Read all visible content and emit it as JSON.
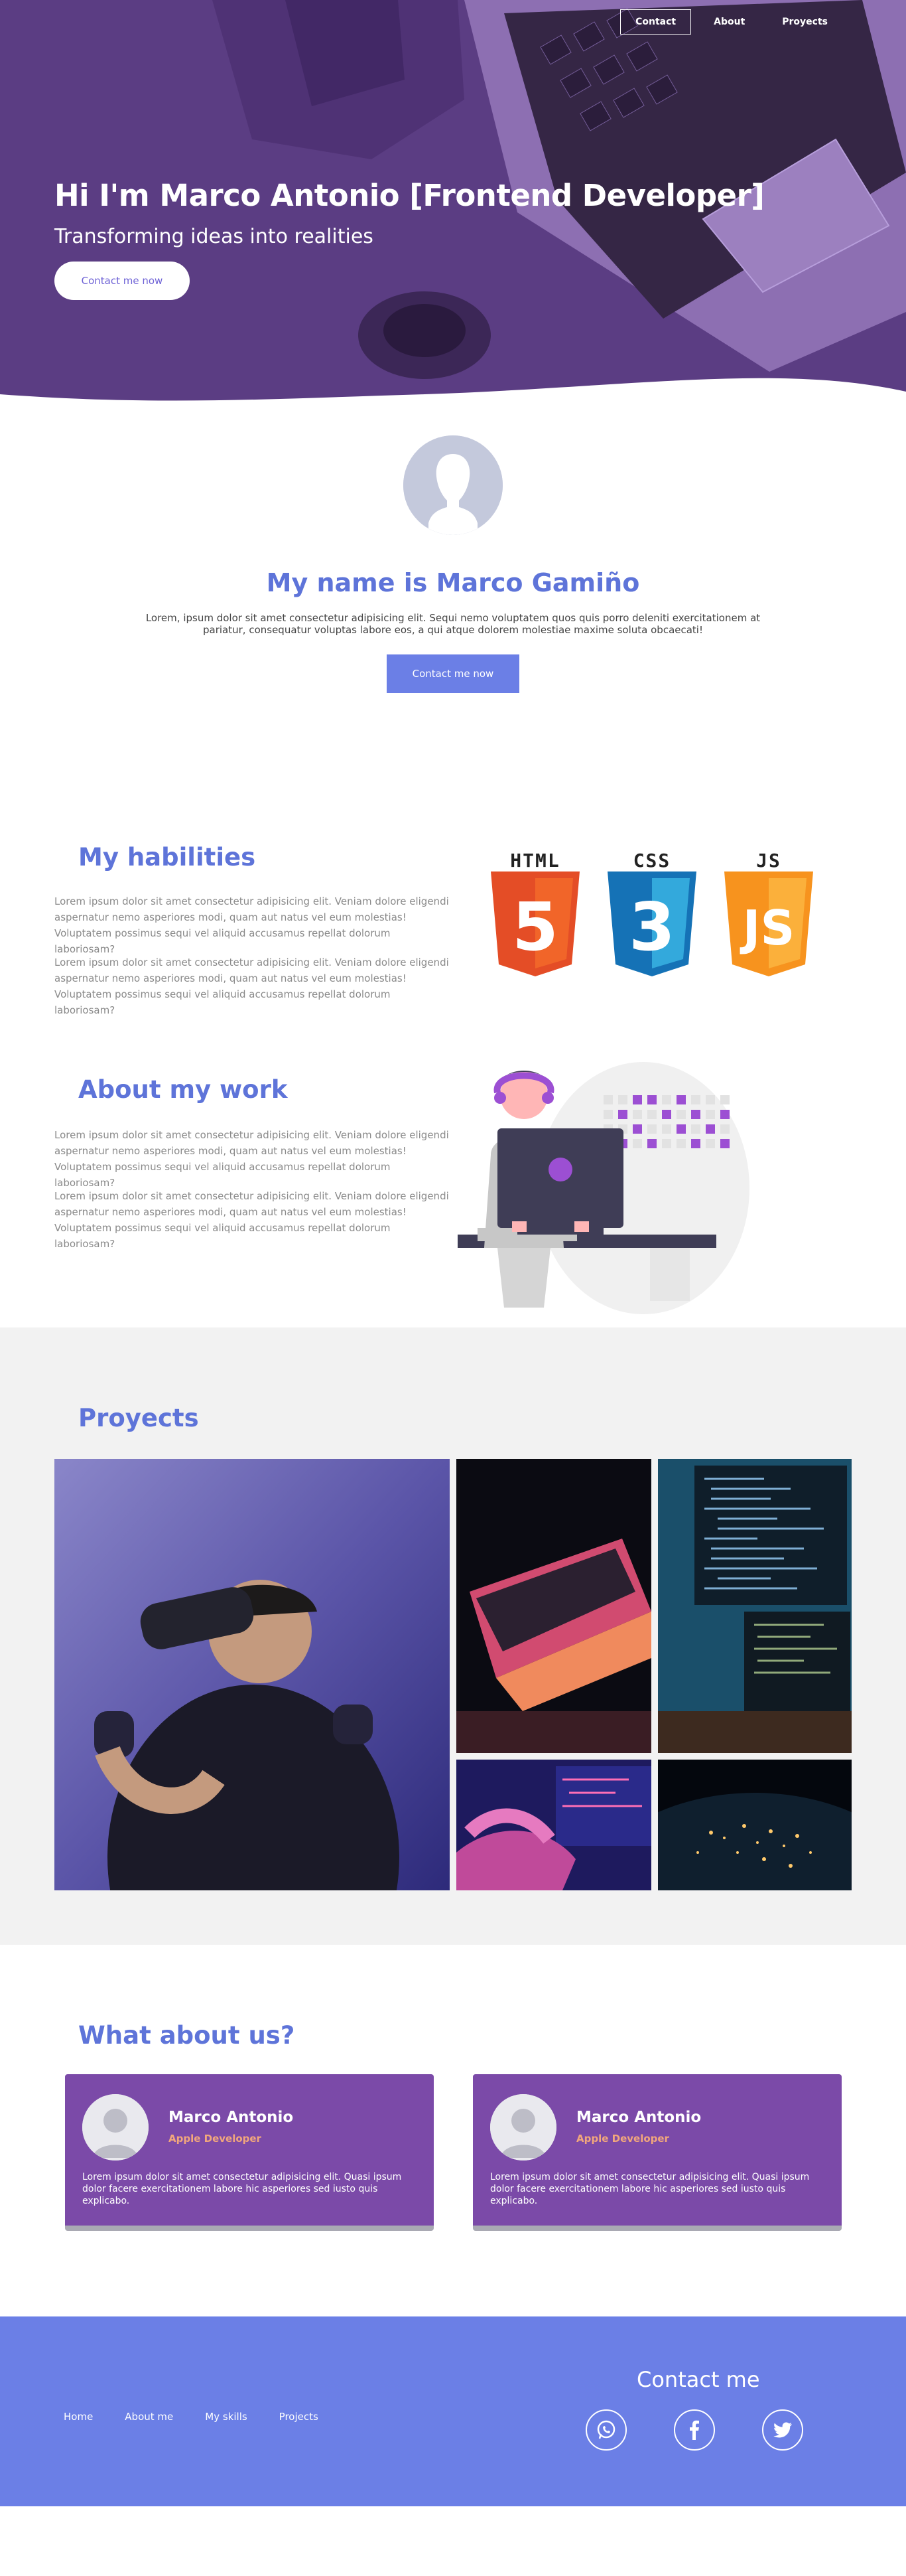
{
  "nav": {
    "items": [
      "Contact",
      "About",
      "Proyects"
    ],
    "active": "Contact"
  },
  "hero": {
    "title": "Hi I'm Marco Antonio [Frontend Developer]",
    "subtitle": "Transforming ideas into realities",
    "button": "Contact me now"
  },
  "intro": {
    "title": "My name is Marco Gamiño",
    "text": "Lorem, ipsum dolor sit amet consectetur adipisicing elit. Sequi nemo voluptatem quos quis porro deleniti exercitationem at pariatur, consequatur voluptas labore eos, a qui atque dolorem molestiae maxime soluta obcaecati!",
    "button": "Contact me now"
  },
  "habilities": {
    "title": "My habilities",
    "p1": "Lorem ipsum dolor sit amet consectetur adipisicing elit. Veniam dolore eligendi aspernatur nemo asperiores modi, quam aut natus vel eum molestias! Voluptatem possimus sequi vel aliquid accusamus repellat dolorum laboriosam?",
    "p2": "Lorem ipsum dolor sit amet consectetur adipisicing elit. Veniam dolore eligendi aspernatur nemo asperiores modi, quam aut natus vel eum molestias! Voluptatem possimus sequi vel aliquid accusamus repellat dolorum laboriosam?",
    "logos": [
      {
        "label": "HTML",
        "number": "5",
        "color": "#e44d26",
        "shade": "#f16529"
      },
      {
        "label": "CSS",
        "number": "3",
        "color": "#1572b6",
        "shade": "#33a9dc"
      },
      {
        "label": "JS",
        "number": "JS",
        "color": "#f7931e",
        "shade": "#fbb03b"
      }
    ]
  },
  "work": {
    "title": "About my work",
    "p1": "Lorem ipsum dolor sit amet consectetur adipisicing elit. Veniam dolore eligendi aspernatur nemo asperiores modi, quam aut natus vel eum molestias! Voluptatem possimus sequi vel aliquid accusamus repellat dolorum laboriosam?",
    "p2": "Lorem ipsum dolor sit amet consectetur adipisicing elit. Veniam dolore eligendi aspernatur nemo asperiores modi, quam aut natus vel eum molestias! Voluptatem possimus sequi vel aliquid accusamus repellat dolorum laboriosam?"
  },
  "projects": {
    "title": "Proyects"
  },
  "about": {
    "title": "What about us?",
    "cards": [
      {
        "name": "Marco Antonio",
        "role": "Apple Developer",
        "text": "Lorem ipsum dolor sit amet consectetur adipisicing elit. Quasi ipsum dolor facere exercitationem labore hic asperiores sed iusto quis explicabo."
      },
      {
        "name": "Marco Antonio",
        "role": "Apple Developer",
        "text": "Lorem ipsum dolor sit amet consectetur adipisicing elit. Quasi ipsum dolor facere exercitationem labore hic asperiores sed iusto quis explicabo."
      }
    ]
  },
  "footer": {
    "links": [
      "Home",
      "About me",
      "My skills",
      "Projects"
    ],
    "contact_title": "Contact me",
    "social": [
      "whatsapp-icon",
      "facebook-icon",
      "twitter-icon"
    ]
  },
  "colors": {
    "hero": "#5b3d83",
    "accent": "#5e74d9",
    "button": "#6b7fe6",
    "card": "#7b4aa8",
    "role": "#f2a77c"
  }
}
